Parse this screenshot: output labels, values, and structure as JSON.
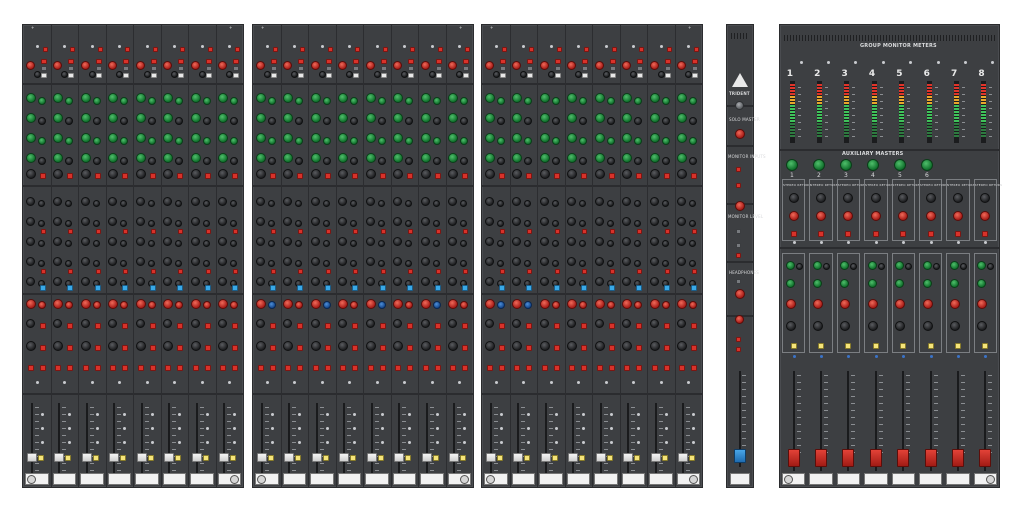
{
  "brand": {
    "name": "TRIDENT",
    "logo_icon": "trident-triangle-logo"
  },
  "console": {
    "input_bays": 3,
    "channels_per_bay": 8,
    "colors": {
      "panel": "#3d3f42",
      "knob_green": "#11712d",
      "knob_red": "#a81d18",
      "knob_blue": "#16488f",
      "button_red": "#d8322a",
      "button_cyan": "#39a9e8",
      "button_yellow": "#f5e47a",
      "fader_cap_white": "#e0e0e0",
      "fader_cap_red": "#c02a22",
      "fader_cap_blue": "#2f8bd0"
    }
  },
  "master_section": {
    "labels": {
      "solo_master": "SOLO MASTER",
      "monitor_inputs": "MONITOR INPUTS",
      "monitor_level": "MONITOR LEVEL",
      "headphones": "HEADPHONES"
    }
  },
  "group_section": {
    "meters_title": "GROUP MONITOR METERS",
    "meter_numbers": [
      "1",
      "2",
      "3",
      "4",
      "5",
      "6",
      "7",
      "8"
    ],
    "aux_title": "AUXILIARY MASTERS",
    "aux_numbers": [
      "1",
      "2",
      "3",
      "4",
      "5",
      "6"
    ],
    "stereo_labels": [
      "STEREO RETURN",
      "STEREO RETURN",
      "STEREO RETURN",
      "STEREO RETURN",
      "STEREO RETURN",
      "STEREO RETURN",
      "STEREO RETURN",
      "STEREO RETURN"
    ]
  }
}
